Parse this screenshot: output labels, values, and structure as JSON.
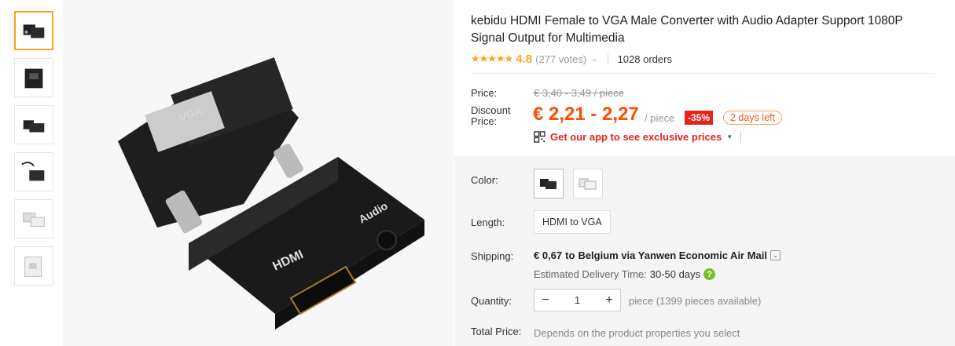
{
  "product": {
    "title": "kebidu HDMI Female to VGA Male Converter with Audio Adapter Support 1080P Signal Output for Multimedia",
    "rating_stars": "★★★★★",
    "rating": "4.8",
    "votes": "(277 votes)",
    "orders": "1028 orders"
  },
  "price": {
    "label": "Price:",
    "original": "€ 3,40 - 3,49 / piece",
    "discount_label": "Discount Price:",
    "discount": "€ 2,21 - 2,27",
    "per_piece": "/ piece",
    "discount_badge": "-35%",
    "days_left": "2 days left",
    "app_promo": "Get our app to see exclusive prices"
  },
  "options": {
    "color_label": "Color:",
    "colors": [
      "black",
      "white"
    ],
    "length_label": "Length:",
    "length_value": "HDMI to VGA"
  },
  "shipping": {
    "label": "Shipping:",
    "cost": "€ 0,67",
    "to_text": "to",
    "destination": "Belgium via Yanwen Economic Air Mail",
    "estimated_label": "Estimated Delivery Time:",
    "estimated_days": "30-50  days"
  },
  "quantity": {
    "label": "Quantity:",
    "minus": "−",
    "value": "1",
    "plus": "+",
    "available": "piece (1399 pieces available)"
  },
  "total": {
    "label": "Total Price:",
    "text": "Depends on the product properties you select"
  },
  "colors": {
    "accent": "#f7a51e",
    "price": "#ff4d00",
    "badge": "#e4241b"
  }
}
